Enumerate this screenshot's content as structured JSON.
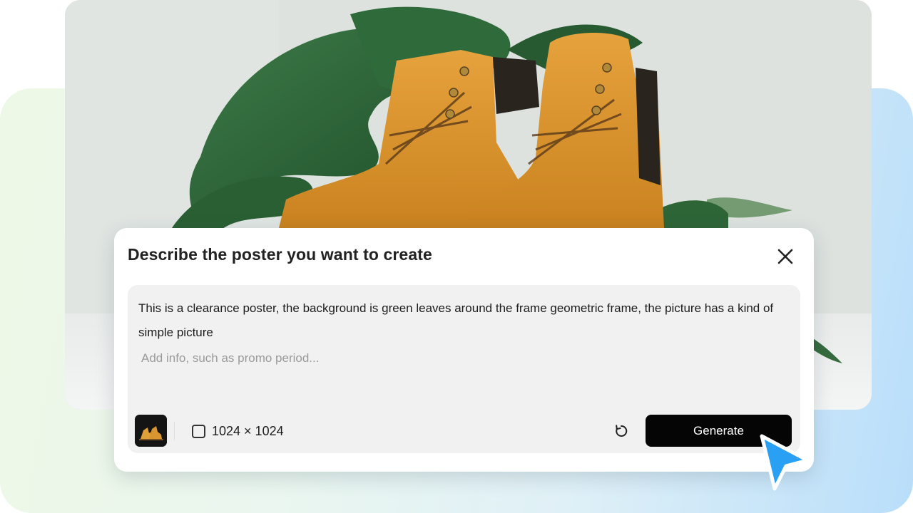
{
  "dialog": {
    "title": "Describe the poster you want to create",
    "prompt_text": "This is a clearance poster, the background is green leaves around the frame geometric frame, the picture has a kind of simple picture",
    "extra_info_placeholder": "Add info, such as promo period...",
    "extra_info_value": "",
    "size_label": "1024 × 1024",
    "size_checked": false,
    "generate_label": "Generate",
    "icons": {
      "close": "close-icon",
      "reset": "refresh-icon",
      "thumbnail": "boots-thumbnail",
      "cursor": "pointer-cursor-icon"
    }
  },
  "colors": {
    "accent_cursor": "#2aa0f5",
    "generate_bg": "#050505",
    "prompt_bg": "#f1f1f1"
  }
}
